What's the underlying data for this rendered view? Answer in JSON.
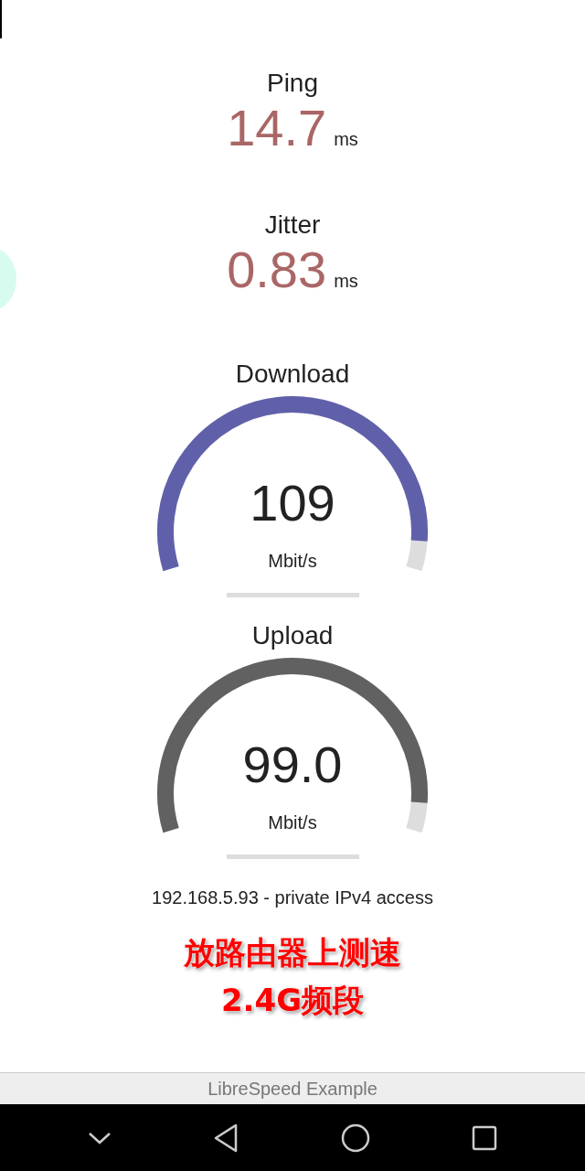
{
  "stats": [
    {
      "label": "Ping",
      "value": "14.7",
      "unit": "ms"
    },
    {
      "label": "Jitter",
      "value": "0.83",
      "unit": "ms"
    }
  ],
  "gauges": [
    {
      "label": "Download",
      "value": "109",
      "unit": "Mbit/s",
      "color": "#6060aa"
    },
    {
      "label": "Upload",
      "value": "99.0",
      "unit": "Mbit/s",
      "color": "#616161"
    }
  ],
  "ip_info": "192.168.5.93 - private IPv4 access",
  "annotation": [
    "放路由器上测速",
    "2.4G频段"
  ],
  "footer": "LibreSpeed Example"
}
